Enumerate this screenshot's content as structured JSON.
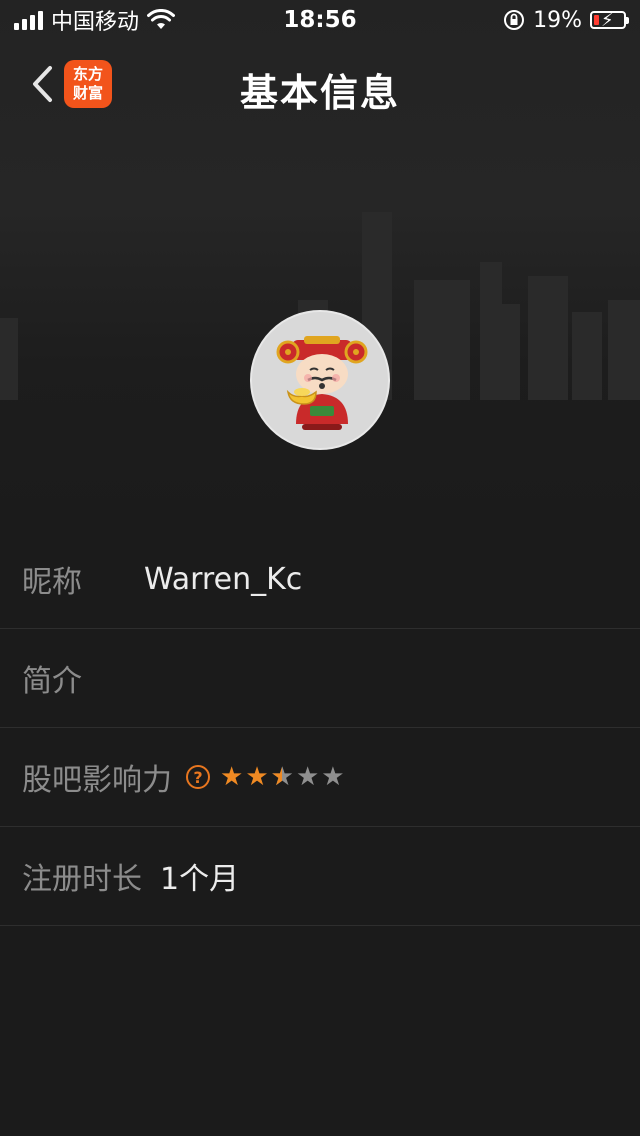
{
  "status_bar": {
    "carrier": "中国移动",
    "time": "18:56",
    "battery_percent": "19%",
    "battery_level": 0.19,
    "icons": [
      "signal-icon",
      "wifi-icon",
      "orientation-lock-icon",
      "battery-icon",
      "charging-bolt-icon"
    ]
  },
  "nav": {
    "title": "基本信息",
    "logo_text_line1": "东方",
    "logo_text_line2": "财富",
    "back_icon": "chevron-left-icon"
  },
  "profile": {
    "avatar_icon": "caishen-avatar-icon"
  },
  "rows": {
    "nickname_label": "昵称",
    "nickname_value": "Warren_Kc",
    "intro_label": "简介",
    "influence_label": "股吧影响力",
    "influence_help_glyph": "?",
    "influence_rating": 2.5,
    "influence_max": 5,
    "registration_label": "注册时长",
    "registration_value": "1个月"
  },
  "colors": {
    "background": "#1b1b1b",
    "accent_orange": "#f08a23",
    "logo_orange": "#f2541b",
    "label_gray": "#8c8c8c",
    "battery_low": "#ff3b30"
  }
}
